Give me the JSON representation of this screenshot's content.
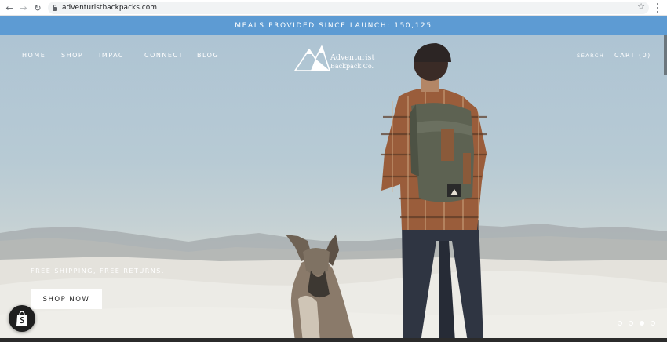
{
  "browser": {
    "url": "adventuristbackpacks.com",
    "back_icon": "back-arrow-icon",
    "forward_icon": "forward-arrow-icon",
    "reload_icon": "reload-icon",
    "bookmark_icon": "star-icon",
    "menu_icon": "kebab-menu-icon"
  },
  "announcement": {
    "text": "MEALS PROVIDED SINCE LAUNCH: 150,125",
    "background": "#5d9bd3"
  },
  "nav": {
    "left": [
      "HOME",
      "SHOP",
      "IMPACT",
      "CONNECT",
      "BLOG"
    ],
    "search": "SEARCH",
    "cart": "CART (0)"
  },
  "logo": {
    "line1": "Adventurist",
    "line2": "Backpack Co."
  },
  "hero": {
    "tagline": "FREE SHIPPING, FREE RETURNS.",
    "cta": "SHOP NOW",
    "slides_total": 4,
    "active_slide": 3
  },
  "badge": {
    "icon": "shopify-bag-icon"
  }
}
